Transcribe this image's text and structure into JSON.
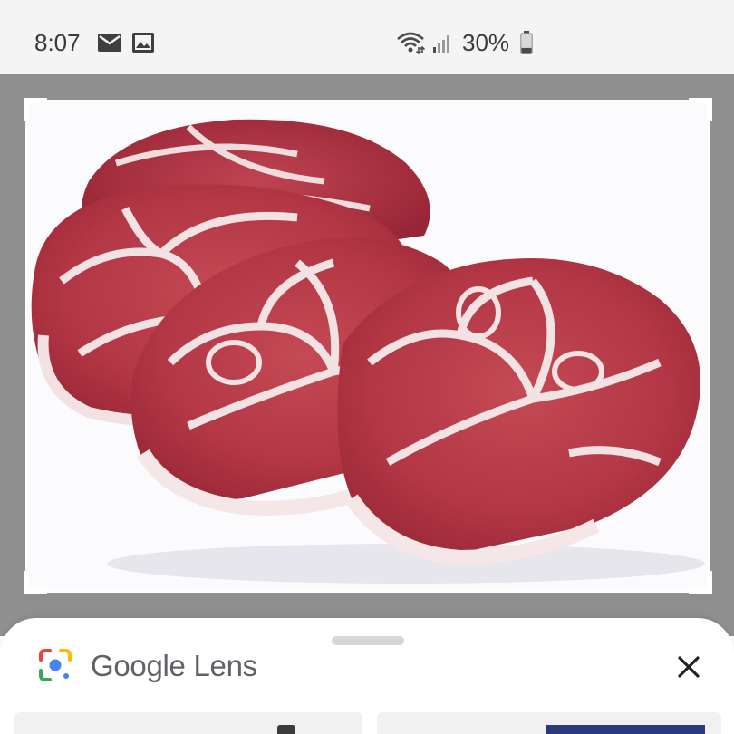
{
  "status_bar": {
    "time": "8:07",
    "battery_percent": "30%",
    "battery_level": 0.3,
    "icons": [
      "mail-icon",
      "image-icon",
      "wifi-icon",
      "signal-icon",
      "battery-icon"
    ]
  },
  "viewer": {
    "image_subject": "raw-pork-shoulder-steaks",
    "background_color": "#8f8f8f"
  },
  "lens_panel": {
    "title": "Google Lens",
    "close_icon": "close-icon",
    "logo_icon": "google-lens-icon"
  },
  "colors": {
    "lens_blue": "#4285f4",
    "lens_red": "#ea4335",
    "lens_yellow": "#fbbc05",
    "lens_green": "#34a853",
    "title_gray": "#5f6368"
  }
}
